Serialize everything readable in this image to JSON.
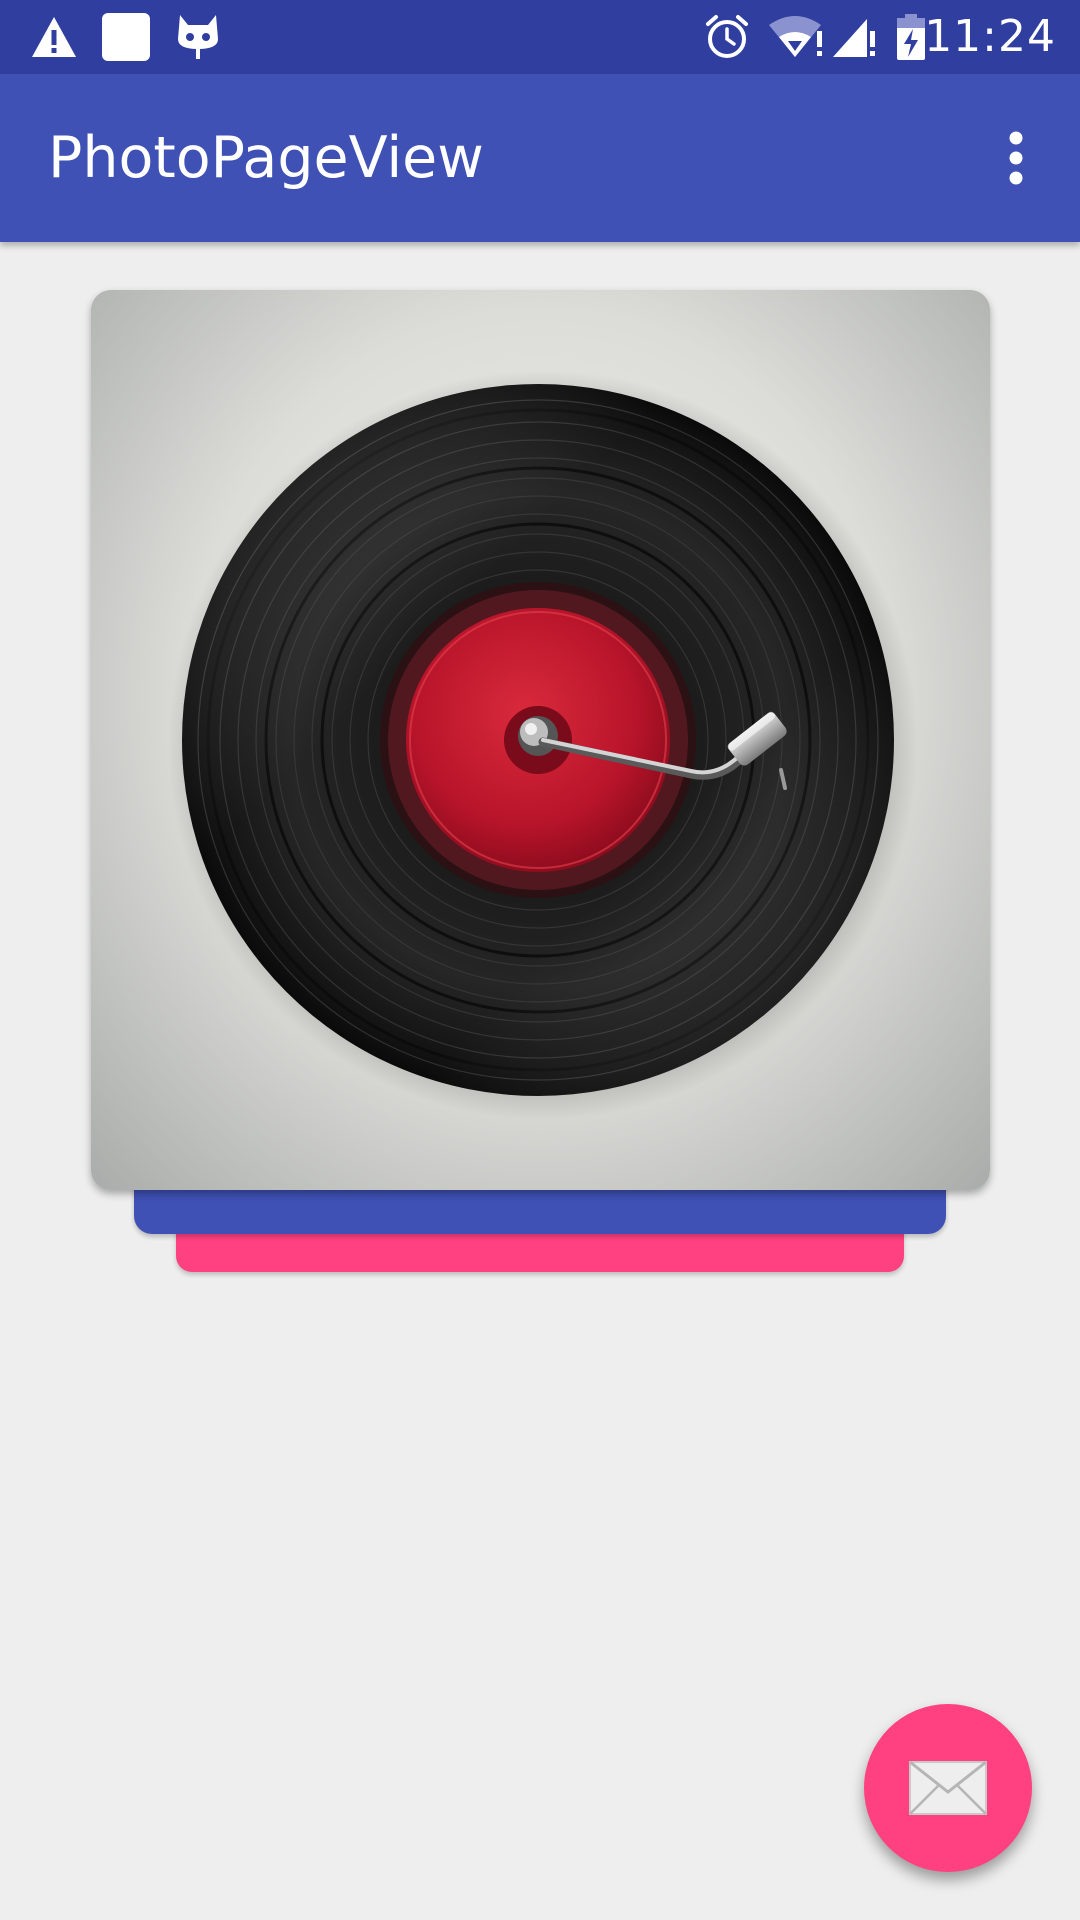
{
  "status_bar": {
    "time": "11:24",
    "icons": [
      "warning-icon",
      "notification-square-icon",
      "cyanogen-mascot-icon",
      "alarm-icon",
      "wifi-alert-icon",
      "signal-alert-icon",
      "battery-charging-icon"
    ]
  },
  "app_bar": {
    "title": "PhotoPageView",
    "menu_icon": "more-vert-icon"
  },
  "main": {
    "photo_subject": "vinyl-record-turntable",
    "stack_colors": [
      "#3f51b5",
      "#ff4081"
    ]
  },
  "fab": {
    "icon": "mail-icon",
    "color": "#ff4081"
  },
  "colors": {
    "status_bar": "#303f9f",
    "primary": "#3f51b5",
    "accent": "#ff4081",
    "background": "#eeeeee"
  }
}
